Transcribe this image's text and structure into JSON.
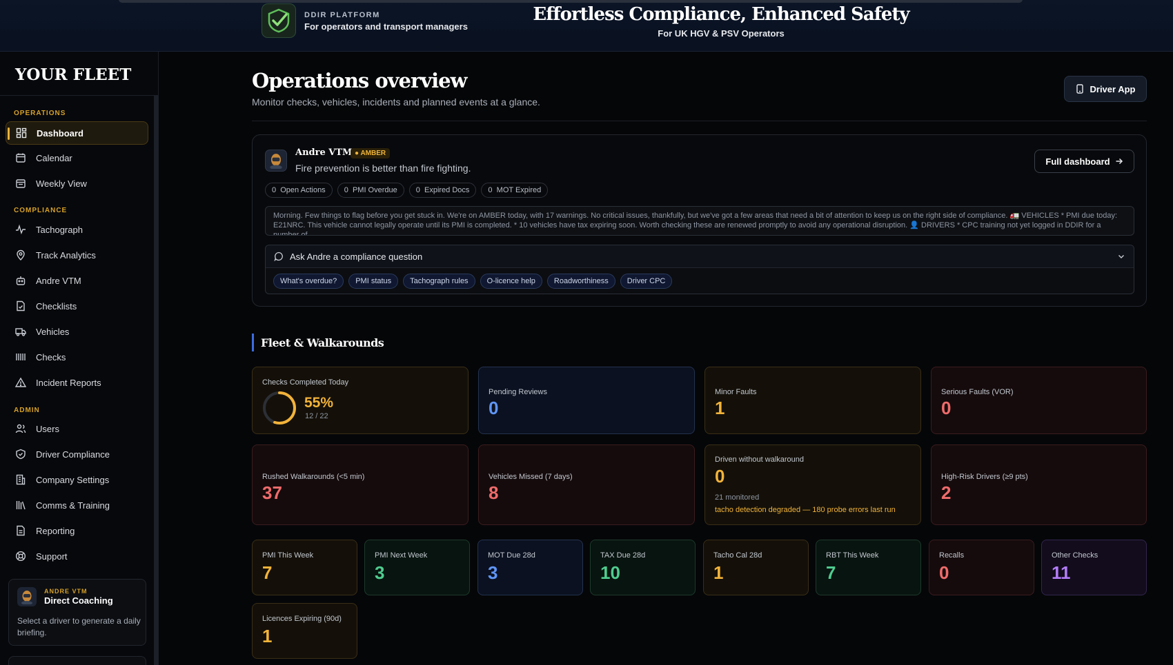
{
  "banner": {
    "kicker": "DDIR PLATFORM",
    "subtitle": "For operators and transport managers",
    "hero_title": "Effortless Compliance, Enhanced Safety",
    "hero_subtitle": "For UK HGV & PSV Operators"
  },
  "sidebar": {
    "title": "YOUR FLEET",
    "sections": {
      "operations": "OPERATIONS",
      "compliance": "COMPLIANCE",
      "admin": "ADMIN"
    },
    "items": [
      {
        "label": "Dashboard",
        "icon": "dashboard-icon",
        "active": true
      },
      {
        "label": "Calendar",
        "icon": "calendar-icon"
      },
      {
        "label": "Weekly View",
        "icon": "weekly-view-icon"
      },
      {
        "label": "Tachograph",
        "icon": "pulse-icon"
      },
      {
        "label": "Track Analytics",
        "icon": "map-pin-icon"
      },
      {
        "label": "Andre VTM",
        "icon": "bot-icon"
      },
      {
        "label": "Checklists",
        "icon": "checklist-icon"
      },
      {
        "label": "Vehicles",
        "icon": "truck-icon"
      },
      {
        "label": "Checks",
        "icon": "barcode-icon"
      },
      {
        "label": "Incident Reports",
        "icon": "warning-icon"
      },
      {
        "label": "Users",
        "icon": "users-icon"
      },
      {
        "label": "Driver Compliance",
        "icon": "shield-check-icon"
      },
      {
        "label": "Company Settings",
        "icon": "building-icon"
      },
      {
        "label": "Comms & Training",
        "icon": "library-icon"
      },
      {
        "label": "Reporting",
        "icon": "report-icon"
      },
      {
        "label": "Support",
        "icon": "lifebuoy-icon"
      }
    ],
    "coaching": {
      "kicker": "ANDRE VTM",
      "title": "Direct Coaching",
      "text": "Select a driver to generate a daily briefing."
    }
  },
  "header": {
    "title": "Operations overview",
    "subtitle": "Monitor checks, vehicles, incidents and planned events at a glance.",
    "driver_app": "Driver App"
  },
  "andre": {
    "name": "Andre VTM",
    "status": "AMBER",
    "quote": "Fire prevention is better than fire fighting.",
    "full_dashboard": "Full dashboard",
    "stats": [
      {
        "count": "0",
        "label": "Open Actions"
      },
      {
        "count": "0",
        "label": "PMI Overdue"
      },
      {
        "count": "0",
        "label": "Expired Docs"
      },
      {
        "count": "0",
        "label": "MOT Expired"
      }
    ],
    "summary": "Morning. Few things to flag before you get stuck in. We're on AMBER today, with 17 warnings. No critical issues, thankfully, but we've got a few areas that need a bit of attention to keep us on the right side of compliance. 🚛 VEHICLES * PMI due today: E21NRC. This vehicle cannot legally operate until its PMI is completed. * 10 vehicles have tax expiring soon. Worth checking these are renewed promptly to avoid any operational disruption. 👤 DRIVERS * CPC training not yet logged in DDIR for a number of...",
    "ask_label": "Ask Andre a compliance question",
    "chips": [
      "What's overdue?",
      "PMI status",
      "Tachograph rules",
      "O-licence help",
      "Roadworthiness",
      "Driver CPC"
    ]
  },
  "fleet": {
    "section_title": "Fleet & Walkarounds",
    "checks_completed": {
      "label": "Checks Completed Today",
      "percent": "55%",
      "ratio": "12 / 22",
      "fraction": 0.55
    },
    "pending_reviews": {
      "label": "Pending Reviews",
      "value": "0"
    },
    "minor_faults": {
      "label": "Minor Faults",
      "value": "1"
    },
    "serious_faults": {
      "label": "Serious Faults (VOR)",
      "value": "0"
    },
    "rushed": {
      "label": "Rushed Walkarounds (<5 min)",
      "value": "37"
    },
    "missed": {
      "label": "Vehicles Missed (7 days)",
      "value": "8"
    },
    "driven_without": {
      "label": "Driven without walkaround",
      "value": "0",
      "monitored": "21 monitored",
      "warning": "tacho detection degraded — 180 probe errors last run"
    },
    "high_risk": {
      "label": "High-Risk Drivers (≥9 pts)",
      "value": "2"
    },
    "small": [
      {
        "label": "PMI This Week",
        "value": "7"
      },
      {
        "label": "PMI Next Week",
        "value": "3"
      },
      {
        "label": "MOT Due 28d",
        "value": "3"
      },
      {
        "label": "TAX Due 28d",
        "value": "10"
      },
      {
        "label": "Tacho Cal 28d",
        "value": "1"
      },
      {
        "label": "RBT This Week",
        "value": "7"
      },
      {
        "label": "Recalls",
        "value": "0"
      },
      {
        "label": "Other Checks",
        "value": "11"
      },
      {
        "label": "Licences Expiring (90d)",
        "value": "1"
      }
    ]
  },
  "colors": {
    "accent_amber": "#f2b33a",
    "accent_blue": "#5f95f5",
    "accent_red": "#ef6b6b",
    "accent_green": "#4fcc8f",
    "accent_purple": "#b27cf7"
  }
}
